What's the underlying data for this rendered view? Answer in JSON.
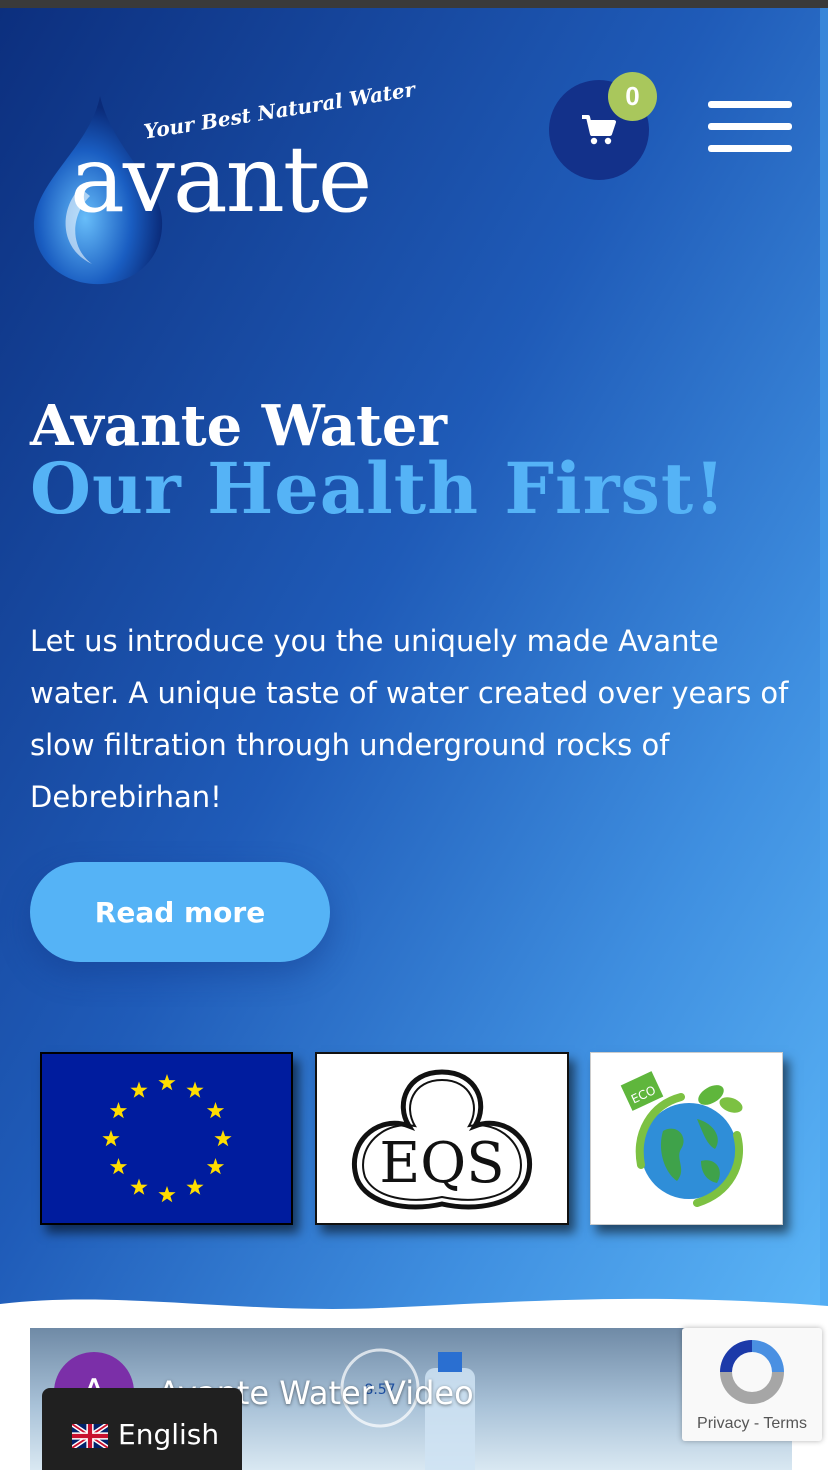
{
  "header": {
    "logo_tagline": "Your Best Natural Water",
    "logo_word": "avante",
    "cart_count": "0"
  },
  "hero": {
    "title_line1": "Avante Water",
    "title_line2": "Our Health First!",
    "intro": "Let us introduce you the uniquely made Avante water. A unique taste of water created over years of slow filtration through underground rocks of Debrebirhan!",
    "button_label": "Read more"
  },
  "certifications": [
    {
      "name": "EU flag"
    },
    {
      "name": "Ethiopian standards mark"
    },
    {
      "name": "ECO friendly globe"
    }
  ],
  "video": {
    "avatar_letter": "A",
    "title": "Avante Water Video"
  },
  "recaptcha": {
    "privacy": "Privacy",
    "separator": " - ",
    "terms": "Terms"
  },
  "language": {
    "label": "English"
  },
  "colors": {
    "accent": "#55b3f6",
    "badge": "#a9c75c",
    "cart_bg": "#13318a"
  }
}
